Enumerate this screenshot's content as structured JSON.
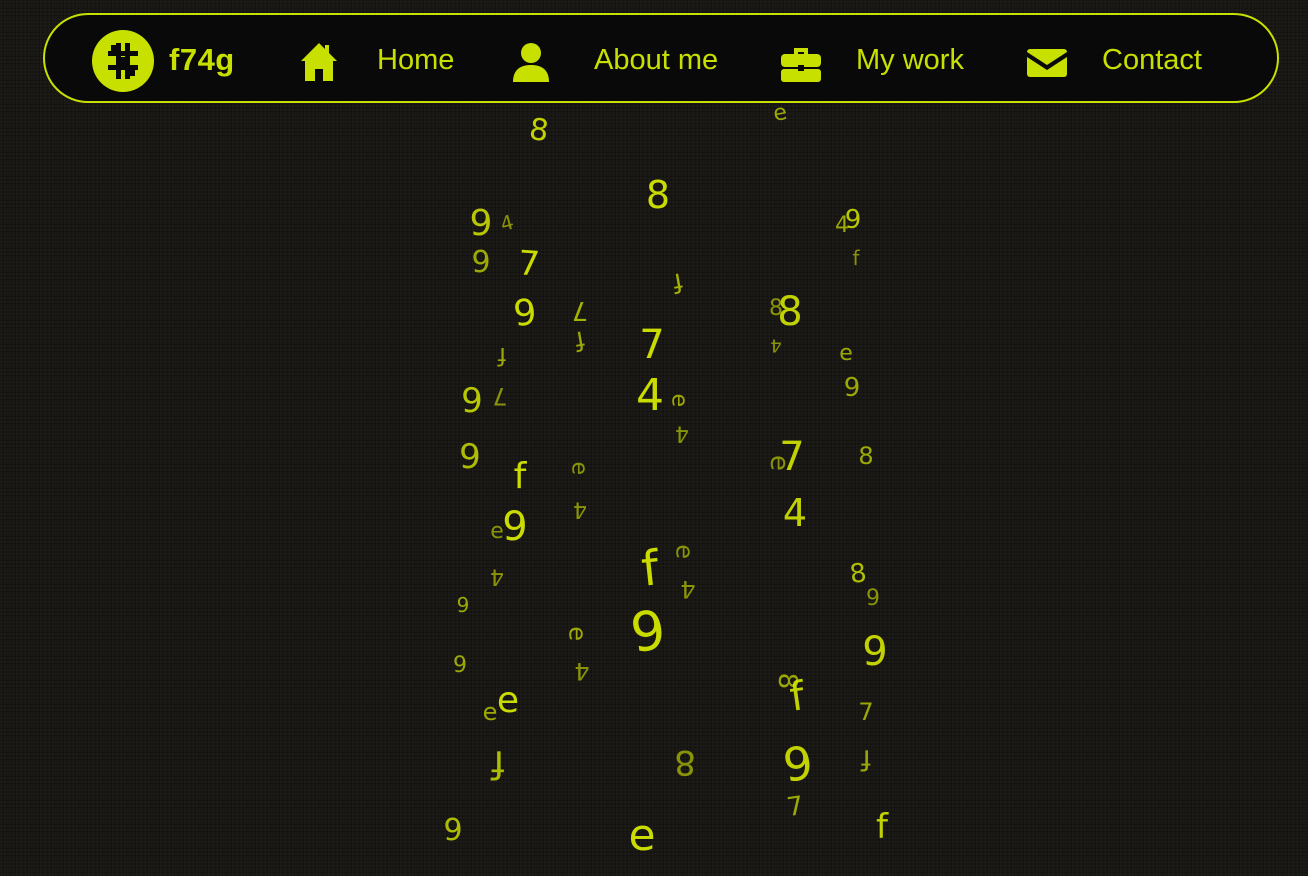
{
  "brand": {
    "name": "f74g",
    "logo_icon": "hash-glyph-icon"
  },
  "nav": {
    "items": [
      {
        "label": "Home",
        "icon": "house-icon"
      },
      {
        "label": "About me",
        "icon": "person-icon"
      },
      {
        "label": "My work",
        "icon": "briefcase-icon"
      },
      {
        "label": "Contact",
        "icon": "envelope-icon"
      }
    ]
  },
  "background": {
    "glyphs": "f74g19e8",
    "accent_color": "#c8e000",
    "base_color": "#171612"
  }
}
